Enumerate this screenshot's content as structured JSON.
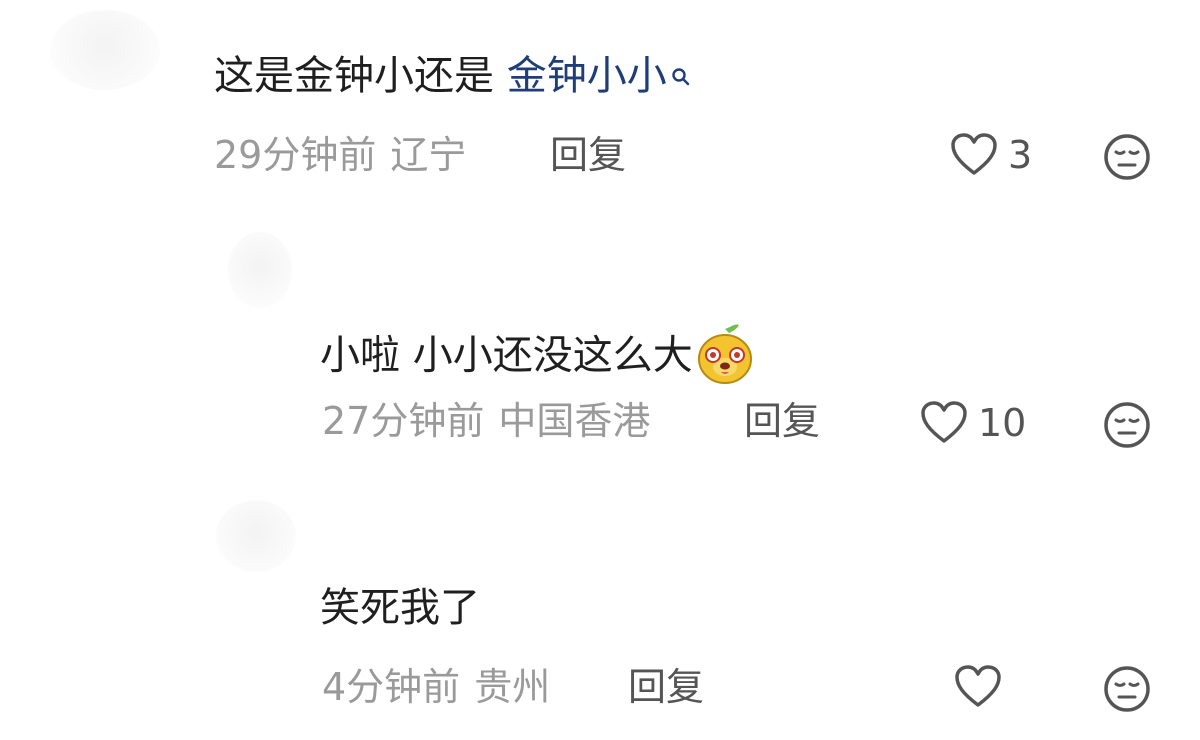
{
  "comments": [
    {
      "text": "这是金钟小还是 ",
      "link": "金钟小小",
      "time": "29分钟前",
      "location": "辽宁",
      "reply": "回复",
      "likes": "3"
    },
    {
      "text": "小啦 小小还没这么大",
      "time": "27分钟前",
      "location": "中国香港",
      "reply": "回复",
      "likes": "10",
      "emoji": "cartoon-face-emoji"
    },
    {
      "text": "笑死我了",
      "time": "4分钟前",
      "location": "贵州",
      "reply": "回复",
      "likes": ""
    }
  ],
  "icons": {
    "like": "heart-icon",
    "dislike": "neutral-face-icon",
    "search": "search-icon"
  },
  "colors": {
    "link": "#1f3d78",
    "meta": "#9a9a9a",
    "text": "#1f1f1f"
  }
}
